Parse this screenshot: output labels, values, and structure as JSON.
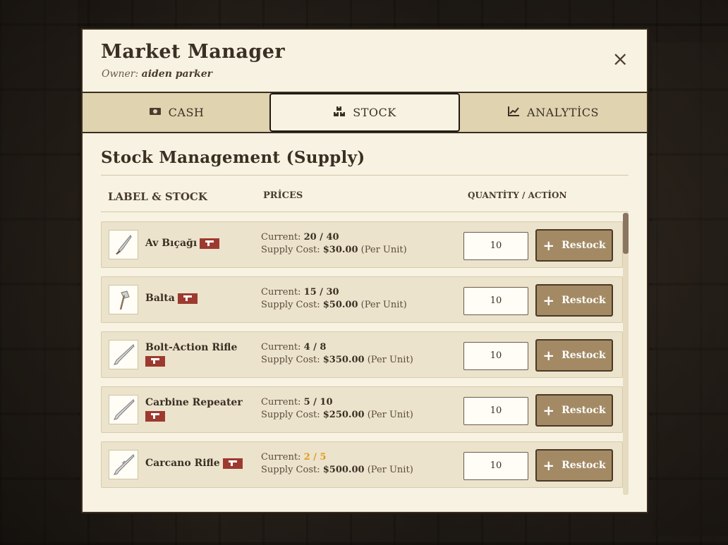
{
  "modal": {
    "title": "Market Manager",
    "owner_prefix": "Owner:",
    "owner_name": "aiden parker",
    "close_icon": "×"
  },
  "tabs": [
    {
      "label": "CASH",
      "icon": "cash-icon",
      "active": false
    },
    {
      "label": "STOCK",
      "icon": "boxes-icon",
      "active": true
    },
    {
      "label": "ANALYTİCS",
      "icon": "chart-line-icon",
      "active": false
    }
  ],
  "section_title": "Stock Management (Supply)",
  "table_headers": {
    "label_stock": "LABEL & STOCK",
    "prices": "PRİCES",
    "quantity_action": "QUANTİTY / ACTİON"
  },
  "price_labels": {
    "current": "Current:",
    "supply_cost": "Supply Cost:",
    "per_unit": "(Per Unit)"
  },
  "restock_label": "Restock",
  "colors": {
    "panel_bg": "#f7f2e2",
    "tab_bg": "#dfd3b0",
    "row_bg": "#ece3cc",
    "button_bg": "#a38a64",
    "badge_bg": "#9d3a30",
    "low_stock": "#e09b1a"
  },
  "items": [
    {
      "name": "Av Bıçağı",
      "current": "20 / 40",
      "low": false,
      "cost": "$30.00",
      "qty": "10",
      "icon": "knife-icon"
    },
    {
      "name": "Balta",
      "current": "15 / 30",
      "low": false,
      "cost": "$50.00",
      "qty": "10",
      "icon": "hatchet-icon"
    },
    {
      "name": "Bolt-Action Rifle",
      "current": "4 / 8",
      "low": false,
      "cost": "$350.00",
      "qty": "10",
      "icon": "rifle-icon"
    },
    {
      "name": "Carbine Repeater",
      "current": "5 / 10",
      "low": false,
      "cost": "$250.00",
      "qty": "10",
      "icon": "rifle-icon"
    },
    {
      "name": "Carcano Rifle",
      "current": "2 / 5",
      "low": true,
      "cost": "$500.00",
      "qty": "10",
      "icon": "rifle-icon"
    }
  ]
}
